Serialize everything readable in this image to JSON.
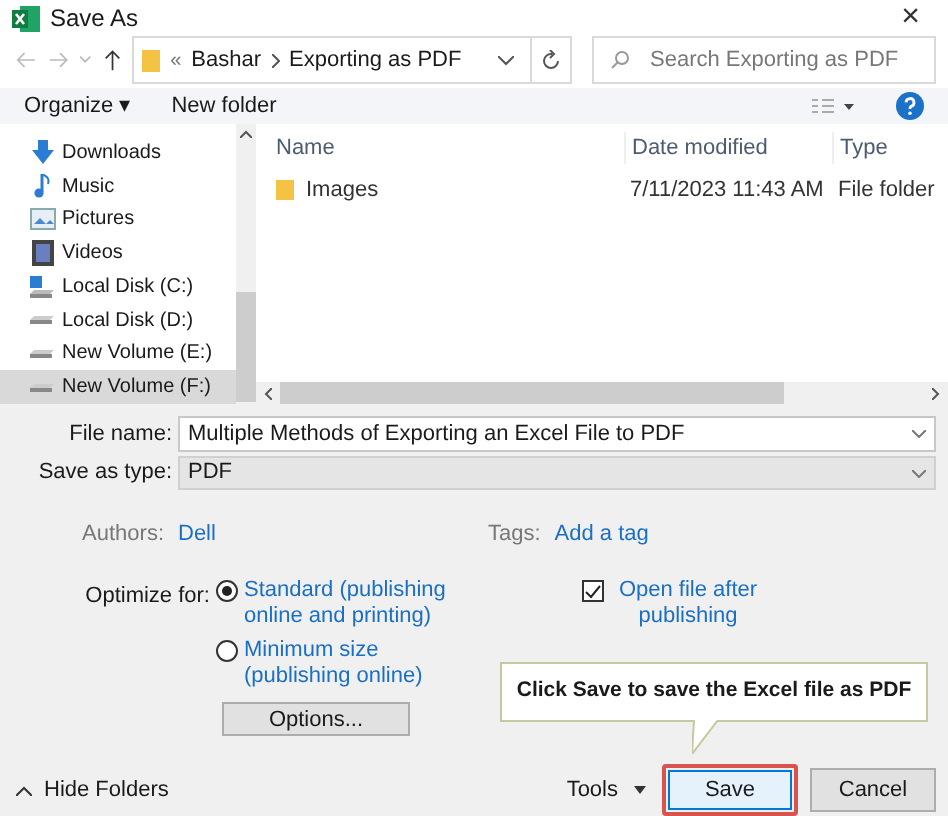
{
  "window": {
    "title": "Save As",
    "close": "×"
  },
  "address": {
    "path": [
      {
        "label": "«"
      },
      {
        "label": "Bashar"
      },
      {
        "label": "Exporting as PDF"
      }
    ]
  },
  "search": {
    "placeholder": "Search Exporting as PDF"
  },
  "toolbar": {
    "organize": "Organize ▾",
    "new_folder": "New folder"
  },
  "sidebar": {
    "items": [
      {
        "label": "Downloads",
        "kind": "download",
        "selected": false
      },
      {
        "label": "Music",
        "kind": "music",
        "selected": false
      },
      {
        "label": "Pictures",
        "kind": "pictures",
        "selected": false
      },
      {
        "label": "Videos",
        "kind": "videos",
        "selected": false
      },
      {
        "label": "Local Disk (C:)",
        "kind": "system-disk",
        "selected": false
      },
      {
        "label": "Local Disk (D:)",
        "kind": "disk",
        "selected": false
      },
      {
        "label": "New Volume (E:)",
        "kind": "disk",
        "selected": false
      },
      {
        "label": "New Volume (F:)",
        "kind": "disk",
        "selected": true
      }
    ]
  },
  "table": {
    "columns": [
      "Name",
      "Date modified",
      "Type"
    ],
    "rows": [
      {
        "cells": [
          "Images",
          "7/11/2023 11:43 AM",
          "File folder"
        ]
      }
    ]
  },
  "form": {
    "file_name": {
      "label": "File name:",
      "value": "Multiple Methods of Exporting an Excel File to PDF"
    },
    "save_as_type": {
      "label": "Save as type:",
      "value": "PDF"
    },
    "authors": {
      "label": "Authors:",
      "value": "Dell"
    },
    "tags": {
      "label": "Tags:",
      "value": "Add a tag"
    },
    "optimize": {
      "label": "Optimize for:",
      "options": [
        {
          "label": "Standard (publishing online and printing)",
          "selected": true
        },
        {
          "label": "Minimum size (publishing online)",
          "selected": false
        }
      ]
    },
    "open_after": {
      "label": "Open file after publishing",
      "checked": true
    },
    "options_button": "Options..."
  },
  "callout": {
    "text": "Click Save to save the Excel file as PDF"
  },
  "footer": {
    "hide_folders": "Hide Folders",
    "tools": "Tools",
    "save": "Save",
    "cancel": "Cancel"
  }
}
